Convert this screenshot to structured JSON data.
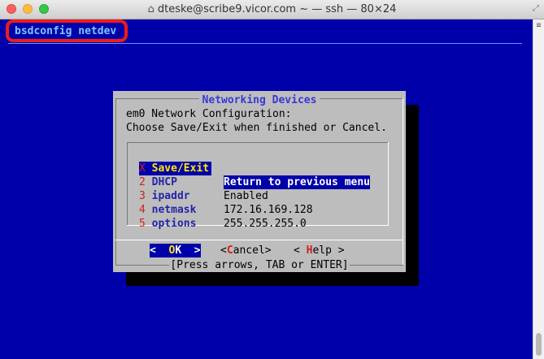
{
  "window": {
    "title": "dteske@scribe9.vicor.com ~ — ssh — 80×24",
    "home_glyph": "⌂",
    "resize_glyph": "⤢"
  },
  "terminal": {
    "backtitle": "bsdconfig netdev",
    "colors": {
      "background": "#0000aa",
      "highlight": "#ee1c1c",
      "backtitle": "#7ac8ff"
    }
  },
  "dialog": {
    "title": "Networking Devices",
    "prompt_line1": "em0 Network Configuration:",
    "prompt_line2": "Choose Save/Exit when finished or Cancel.",
    "items": [
      {
        "hotkey": "X",
        "name": " Save/Exit",
        "desc": "Return to previous menu",
        "selected": true
      },
      {
        "hotkey": "2",
        "name": " DHCP",
        "desc": "Enabled"
      },
      {
        "hotkey": "3",
        "name": " ipaddr",
        "desc": "172.16.169.128"
      },
      {
        "hotkey": "4",
        "name": " netmask",
        "desc": "255.255.255.0"
      },
      {
        "hotkey": "5",
        "name": " options",
        "desc": ""
      }
    ],
    "buttons": {
      "ok": {
        "pre": "<  ",
        "hot": "O",
        "post": "K  >"
      },
      "cancel": {
        "pre": "<",
        "hot": "C",
        "post": "ancel>"
      },
      "help": {
        "pre": "< ",
        "hot": "H",
        "post": "elp >"
      }
    },
    "hint": "[Press arrows, TAB or ENTER]"
  }
}
